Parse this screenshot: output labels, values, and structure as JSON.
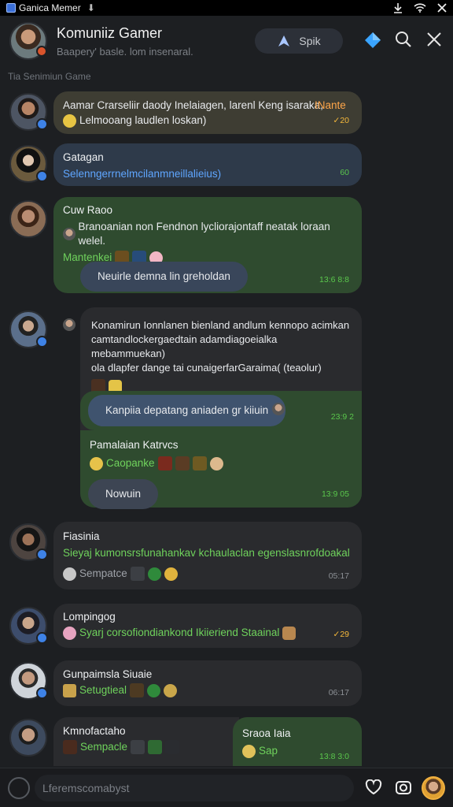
{
  "status_bar": {
    "app_name": "Ganica Memer"
  },
  "header": {
    "title": "Komuniiz Gamer",
    "subtitle": "Baapery' basle.   lom insenaral.",
    "speak_label": "Spik"
  },
  "section_label": "Tia Senimiun Game",
  "messages": [
    {
      "text_1": "Aamar Crarseliir daody Inelaiagen, larenl Keng isaraka,",
      "name": "INante",
      "text_2": "Lelmooang laudlen loskan)",
      "time": "✓20"
    },
    {
      "name": "Gatagan",
      "text": "Selenngerrnelmcilanmneillalieius)",
      "time": "60"
    },
    {
      "name": "Cuw Raoo",
      "text": "Branoanian non Fendnon lycliorajontaff neatak loraan welel.",
      "subtext": "Mantenkei",
      "reply": "Neuirle demna lin greholdan",
      "time": "13:6  8:8"
    },
    {
      "quote_line1": "Konamirun Ionnlanen bienland andlum kennopo acimkan",
      "quote_line2": "camtandlockergaedtain adamdiagoeialka mebammuekan)",
      "quote_line3": "ola dlapfer dange tai cunaigerfarGaraima( (teaolur)",
      "reply_pill": "Kanpiia depatang aniaden gr kiiuin",
      "reply_time": "23:9 2",
      "sub_name": "Pamalaian Katrvcs",
      "sub_text": "Caopanke",
      "sub_pill": "Nowuin",
      "sub_time": "13:9  05"
    },
    {
      "name": "Fiasinia",
      "text": "Sieyaj kumonsrsfunahankav kchaulaclan egenslasnrofdoakal",
      "subtext": "Sempatce",
      "time": "05:17"
    },
    {
      "name": "Lompingog",
      "text": "Syarj corsofiondiankond Ikiieriend Staainal",
      "time": "✓29"
    },
    {
      "name": "Gunpaimsla Siuaie",
      "text": "Setugtieal",
      "time": "06:17"
    },
    {
      "name": "Kmnofactaho",
      "text": "Sempacle",
      "side_name": "Sraoa Iaia",
      "side_text": "Sap",
      "side_time": "13:8  3:0"
    }
  ],
  "composer": {
    "placeholder": "Lferemscomabyst"
  },
  "colors": {
    "accent_green": "#6fd25c",
    "accent_orange": "#ffa64a",
    "accent_blue": "#5fa6ff",
    "bg": "#1d1f22"
  }
}
